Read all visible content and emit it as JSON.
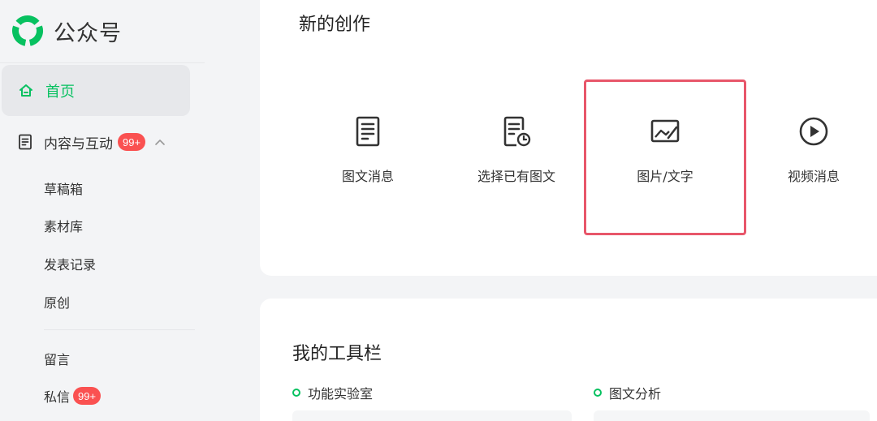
{
  "brand": {
    "name": "公众号",
    "color": "#07c160"
  },
  "sidebar": {
    "home": {
      "label": "首页",
      "icon": "home-icon"
    },
    "content_group": {
      "label": "内容与互动",
      "badge": "99+",
      "icon": "document-icon"
    },
    "sub_items": [
      "草稿箱",
      "素材库",
      "发表记录",
      "原创"
    ],
    "messages": {
      "comments": "留言",
      "private": "私信",
      "private_badge": "99+"
    }
  },
  "create": {
    "title": "新的创作",
    "items": [
      {
        "label": "图文消息",
        "icon": "article-icon"
      },
      {
        "label": "选择已有图文",
        "icon": "history-article-icon"
      },
      {
        "label": "图片/文字",
        "icon": "image-text-icon",
        "selected": true
      },
      {
        "label": "视频消息",
        "icon": "video-play-icon"
      }
    ]
  },
  "toolbar": {
    "title": "我的工具栏",
    "tools": [
      {
        "label": "功能实验室"
      },
      {
        "label": "图文分析"
      }
    ]
  },
  "colors": {
    "accent": "#07c160",
    "badge": "#fa5151",
    "highlight": "#e8566a"
  }
}
